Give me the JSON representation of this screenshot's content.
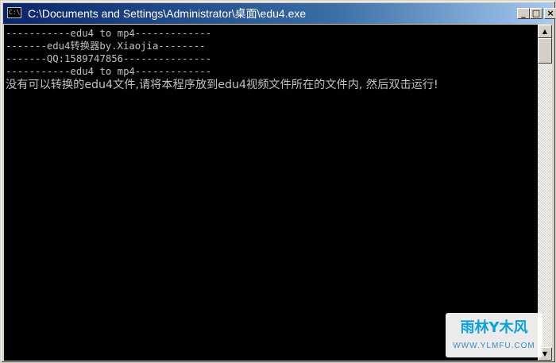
{
  "window": {
    "title": "C:\\Documents and Settings\\Administrator\\桌面\\edu4.exe",
    "icon_label": "C:\\",
    "buttons": {
      "minimize": "_",
      "maximize": "□",
      "close": "×"
    }
  },
  "console": {
    "lines": [
      "-----------edu4 to mp4-------------",
      "-------edu4转换器by.Xiaojia--------",
      "-------QQ:1589747856---------------",
      "-----------edu4 to mp4-------------",
      "没有可以转换的edu4文件,请将本程序放到edu4视频文件所在的文件内, 然后双击运行!"
    ],
    "text_color": "#c0c0c0",
    "background_color": "#000000"
  },
  "scrollbar": {
    "up_arrow": "▲",
    "down_arrow": "▼"
  },
  "watermark": {
    "main": "雨林Y木风",
    "sub": "WWW.YLMFU.COM"
  },
  "colors": {
    "titlebar_start": "#0a246a",
    "titlebar_end": "#a6caf0",
    "window_face": "#d4d0c8"
  }
}
